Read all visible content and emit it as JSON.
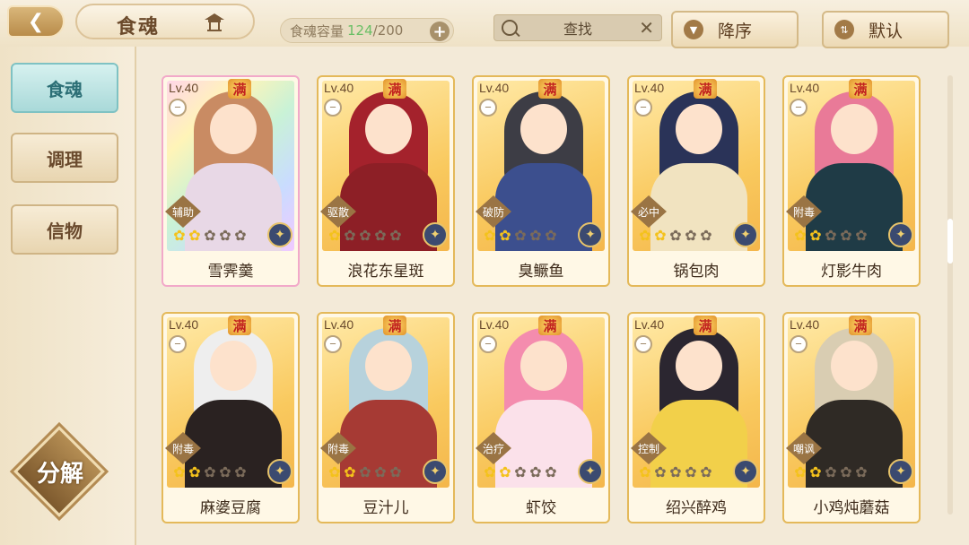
{
  "header": {
    "title": "食魂",
    "capacity_label": "食魂容量",
    "capacity_current": "124",
    "capacity_max": "200",
    "search_placeholder": "查找",
    "sort_label": "降序",
    "default_label": "默认"
  },
  "sidebar": {
    "tabs": [
      {
        "label": "食魂",
        "active": true
      },
      {
        "label": "调理",
        "active": false
      },
      {
        "label": "信物",
        "active": false
      }
    ],
    "decompose_label": "分解"
  },
  "cards": [
    {
      "level": "Lv.40",
      "max": "满",
      "role": "辅助",
      "name": "雪霁羹",
      "stars_on": 2,
      "rainbow": true,
      "hair": "#c98b63",
      "body": "#e8d8e6"
    },
    {
      "level": "Lv.40",
      "max": "满",
      "role": "驱散",
      "name": "浪花东星斑",
      "stars_on": 1,
      "rainbow": false,
      "hair": "#a4222c",
      "body": "#8d1f26"
    },
    {
      "level": "Lv.40",
      "max": "满",
      "role": "破防",
      "name": "臭鳜鱼",
      "stars_on": 2,
      "rainbow": false,
      "hair": "#3d3d45",
      "body": "#3c4f8e"
    },
    {
      "level": "Lv.40",
      "max": "满",
      "role": "必中",
      "name": "锅包肉",
      "stars_on": 2,
      "rainbow": false,
      "hair": "#2a3358",
      "body": "#f1e3c0"
    },
    {
      "level": "Lv.40",
      "max": "满",
      "role": "附毒",
      "name": "灯影牛肉",
      "stars_on": 2,
      "rainbow": false,
      "hair": "#e97a98",
      "body": "#1f3b46"
    },
    {
      "level": "Lv.40",
      "max": "满",
      "role": "附毒",
      "name": "麻婆豆腐",
      "stars_on": 2,
      "rainbow": false,
      "hair": "#eeeeee",
      "body": "#2a2221"
    },
    {
      "level": "Lv.40",
      "max": "满",
      "role": "附毒",
      "name": "豆汁儿",
      "stars_on": 2,
      "rainbow": false,
      "hair": "#b7d2dc",
      "body": "#a63a34"
    },
    {
      "level": "Lv.40",
      "max": "满",
      "role": "治疗",
      "name": "虾饺",
      "stars_on": 2,
      "rainbow": false,
      "hair": "#f48cae",
      "body": "#fbe1ea"
    },
    {
      "level": "Lv.40",
      "max": "满",
      "role": "控制",
      "name": "绍兴醉鸡",
      "stars_on": 1,
      "rainbow": false,
      "hair": "#2b2630",
      "body": "#f2d04a"
    },
    {
      "level": "Lv.40",
      "max": "满",
      "role": "嘲讽",
      "name": "小鸡炖蘑菇",
      "stars_on": 2,
      "rainbow": false,
      "hair": "#d9cdb2",
      "body": "#2f2a25"
    }
  ],
  "colors": {
    "accent_gold": "#e4b95a",
    "active_tab": "#a9d9d9",
    "capacity_green": "#6abf65"
  }
}
